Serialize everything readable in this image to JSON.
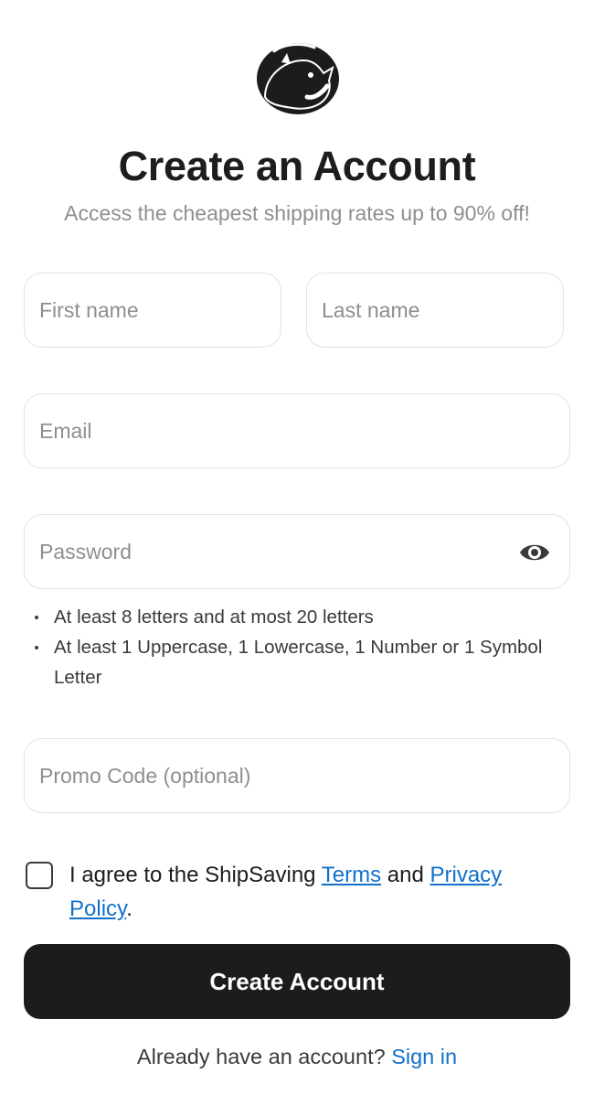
{
  "header": {
    "title": "Create an Account",
    "subtitle": "Access the cheapest shipping rates up to 90% off!",
    "logo_icon": "shipsaving-rhino-logo"
  },
  "form": {
    "first_name": {
      "value": "",
      "placeholder": "First name"
    },
    "last_name": {
      "value": "",
      "placeholder": "Last name"
    },
    "email": {
      "value": "",
      "placeholder": "Email"
    },
    "password": {
      "value": "",
      "placeholder": "Password",
      "toggle_icon": "eye-icon"
    },
    "password_rules": [
      "At least 8 letters and at most 20 letters",
      "At least 1 Uppercase, 1 Lowercase, 1 Number or 1 Symbol Letter"
    ],
    "promo_code": {
      "value": "",
      "placeholder": "Promo Code (optional)"
    },
    "agree": {
      "checked": false,
      "prefix": "I agree to the ShipSaving ",
      "terms_label": "Terms",
      "middle": " and ",
      "privacy_label": "Privacy Policy",
      "suffix": "."
    },
    "submit_label": "Create Account"
  },
  "footer": {
    "prompt": "Already have an account? ",
    "signin_label": "Sign in"
  },
  "colors": {
    "primary_button": "#1c1c1e",
    "link": "#1270c9",
    "placeholder": "#8e8e93",
    "border": "#e2e2e6"
  }
}
